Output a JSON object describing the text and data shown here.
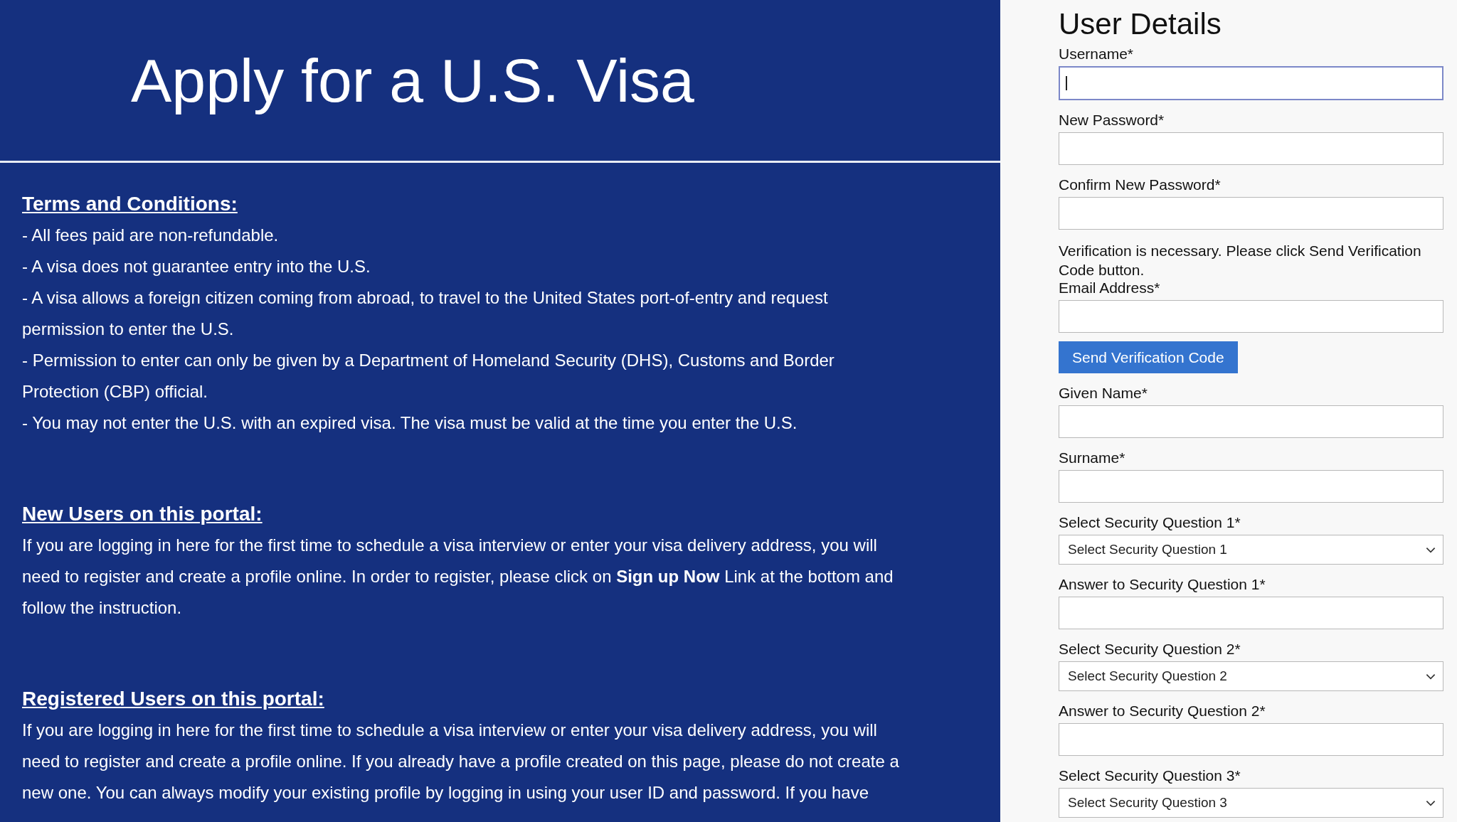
{
  "banner": {
    "title": "Apply for a U.S. Visa"
  },
  "sections": [
    {
      "heading": "Terms and Conditions:",
      "paragraphs": [
        "- All fees paid are non-refundable.",
        "- A visa does not guarantee entry into the U.S.",
        "- A visa allows a foreign citizen coming from abroad, to travel to the United States port-of-entry and request permission to enter the U.S.",
        "- Permission to enter can only be given by a Department of Homeland Security (DHS), Customs and Border Protection (CBP) official.",
        "- You may not enter the U.S. with an expired visa. The visa must be valid at the time you enter the U.S."
      ]
    },
    {
      "heading": "New Users on this portal:",
      "paragraphs": [
        "If you are logging in here for the first time to schedule a visa interview or enter your visa delivery address, you will need to register and create a profile online. In order to register, please click on **Sign up Now** Link at the bottom and follow the instruction."
      ]
    },
    {
      "heading": "Registered Users on this portal:",
      "paragraphs": [
        "If you are logging in here for the first time to schedule a visa interview or enter your visa delivery address, you will need to register and create a profile online. If you already have a profile created on this page, please do not create a new one. You can always modify your existing profile by logging in using your user ID and password. If you have"
      ]
    }
  ],
  "form": {
    "title": "User Details",
    "items": [
      {
        "kind": "input",
        "label": "Username*",
        "focused": true
      },
      {
        "kind": "input",
        "label": "New Password*",
        "focused": false
      },
      {
        "kind": "input",
        "label": "Confirm New Password*",
        "focused": false
      },
      {
        "kind": "note",
        "text": "Verification is necessary. Please click Send Verification Code button."
      },
      {
        "kind": "input",
        "label": "Email Address*",
        "focused": false
      },
      {
        "kind": "button",
        "label": "Send Verification Code"
      },
      {
        "kind": "input",
        "label": "Given Name*",
        "focused": false
      },
      {
        "kind": "input",
        "label": "Surname*",
        "focused": false
      },
      {
        "kind": "select",
        "label": "Select Security Question 1*",
        "value": "Select Security Question 1"
      },
      {
        "kind": "input",
        "label": "Answer to Security Question 1*",
        "focused": false
      },
      {
        "kind": "select",
        "label": "Select Security Question 2*",
        "value": "Select Security Question 2"
      },
      {
        "kind": "input",
        "label": "Answer to Security Question 2*",
        "focused": false
      },
      {
        "kind": "select",
        "label": "Select Security Question 3*",
        "value": "Select Security Question 3"
      }
    ]
  }
}
